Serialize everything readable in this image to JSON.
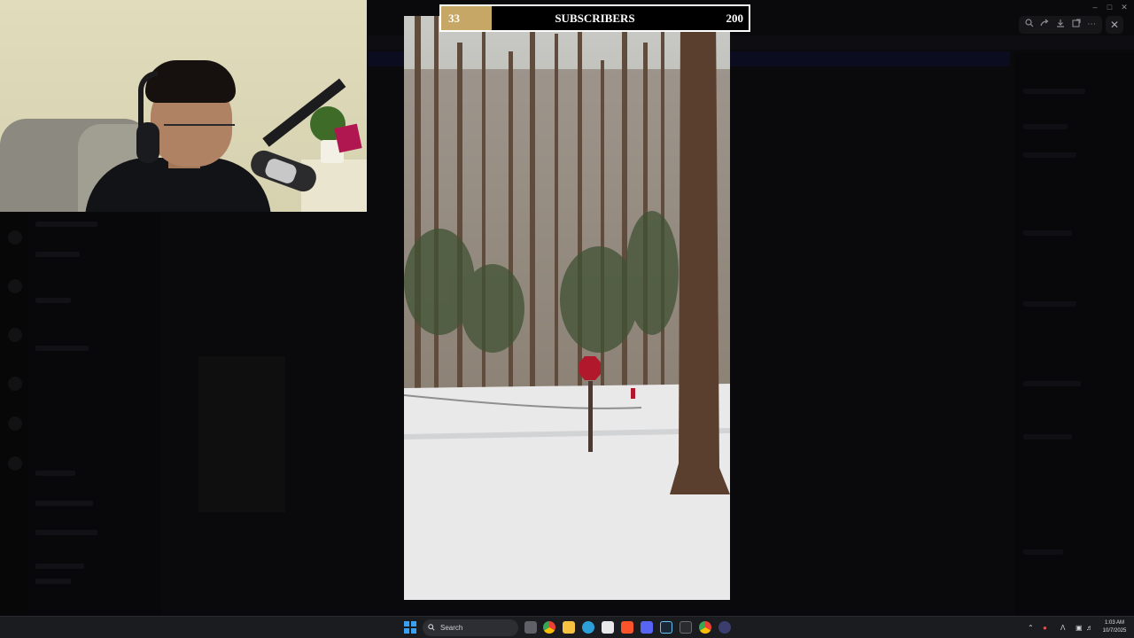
{
  "stream_overlay": {
    "subscriber_goal": {
      "current_text": "33",
      "label": "SUBSCRIBERS",
      "target_text": "200",
      "current": 33,
      "target": 200,
      "fill_color": "#c6a765",
      "border_color": "#ffffff"
    }
  },
  "viewer_toolbar": {
    "icons": [
      "zoom-in-icon",
      "share-icon",
      "download-icon",
      "open-external-icon",
      "more-icon"
    ],
    "close_icon": "close-icon"
  },
  "window_controls": [
    "minimize-icon",
    "maximize-icon",
    "close-icon"
  ],
  "taskbar": {
    "search_placeholder": "Search",
    "pinned_apps": [
      "start-icon",
      "task-view-icon",
      "chrome-icon",
      "file-explorer-icon",
      "edge-icon",
      "store-icon",
      "brave-icon",
      "discord-icon",
      "steam-icon",
      "terminal-icon",
      "chrome-alt-icon",
      "app-icon"
    ],
    "tray_icons": [
      "chevron-up-icon",
      "mic-icon",
      "language-icon",
      "network-icon",
      "volume-icon"
    ],
    "time": "1:03 AM",
    "date": "10/7/2025"
  },
  "colors": {
    "accent_gold": "#c6a765",
    "taskbar_bg": "#1b1c20",
    "stop_sign": "#b2182b"
  }
}
